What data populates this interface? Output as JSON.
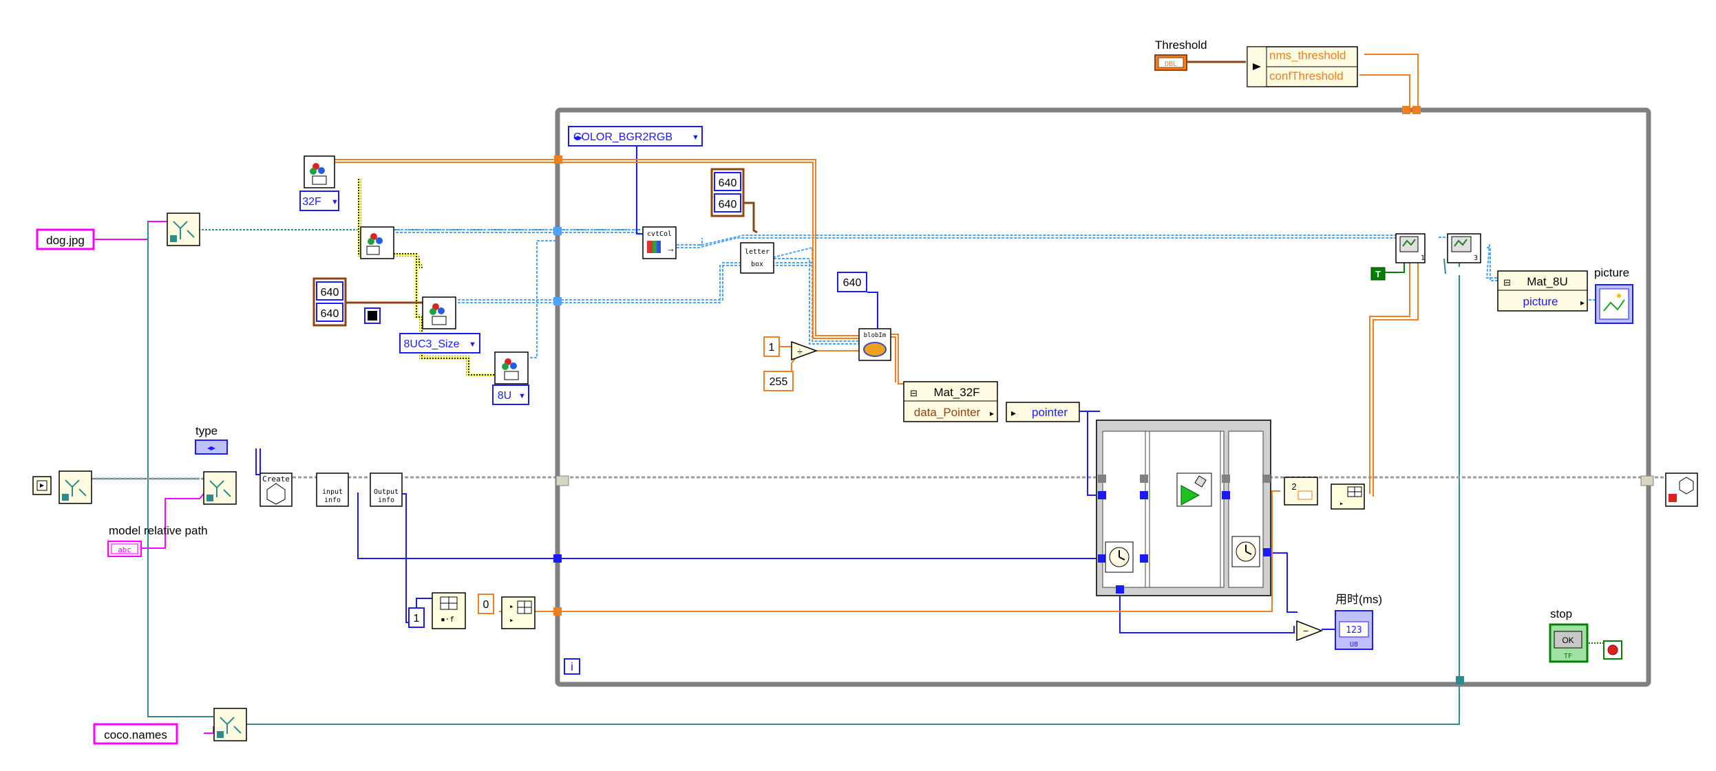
{
  "constants": {
    "image_path": "dog.jpg",
    "names_path": "coco.names",
    "model_label": "model relative path",
    "model_ctrl_text": "abc",
    "type_label": "type",
    "threshold_label": "Threshold",
    "threshold_ctrl_text": "DBL",
    "w1": "640",
    "h1": "640",
    "w2": "640",
    "h2": "640",
    "size640": "640",
    "one_a": "1",
    "val255": "255",
    "one_b": "1",
    "zero": "0",
    "two": "2",
    "true_const": "T"
  },
  "enums": {
    "color_conv": "COLOR_BGR2RGB",
    "type_32f": "32F",
    "type_8uc3": "8UC3_Size",
    "type_8u": "8U"
  },
  "subvi": {
    "create": "Create",
    "input_info": [
      "input",
      "info"
    ],
    "output_info": [
      "Output",
      "info"
    ],
    "cvtcol": "cvtCol",
    "letterbox": [
      "letter",
      "box"
    ],
    "blobfrom": "blobIm"
  },
  "props": {
    "threshold_rows": [
      "nms_threshold",
      "confThreshold"
    ],
    "mat32f_header": "Mat_32F",
    "mat32f_row": "data_Pointer",
    "mat8u_header": "Mat_8U",
    "mat8u_row": "picture",
    "pointer_label": "pointer"
  },
  "indicators": {
    "time_label": "用时(ms)",
    "time_text": "123",
    "time_repr": "U8",
    "picture_label": "picture",
    "stop_label": "stop",
    "stop_button": "OK",
    "stop_tf": "TF"
  },
  "loop": {
    "iteration_terminal": "i"
  },
  "icons": {
    "left_ref": "file-ref-icon",
    "stop_icon": "stop-icon",
    "picture_icon": "picture-indicator-icon",
    "clock_icon": "tick-count-icon",
    "run_icon": "run-arrow-icon"
  },
  "colors": {
    "path_pink": "#ff00ff",
    "refnum_teal": "#2e8b8b",
    "int_blue": "#1a1aff",
    "float_orange": "#f07d1e",
    "cluster_brown": "#8b4513",
    "image_blue": "#4da3ff",
    "bool_green": "#008000",
    "loop_gray": "#808080",
    "bundle_yellow": "#b8a800"
  }
}
